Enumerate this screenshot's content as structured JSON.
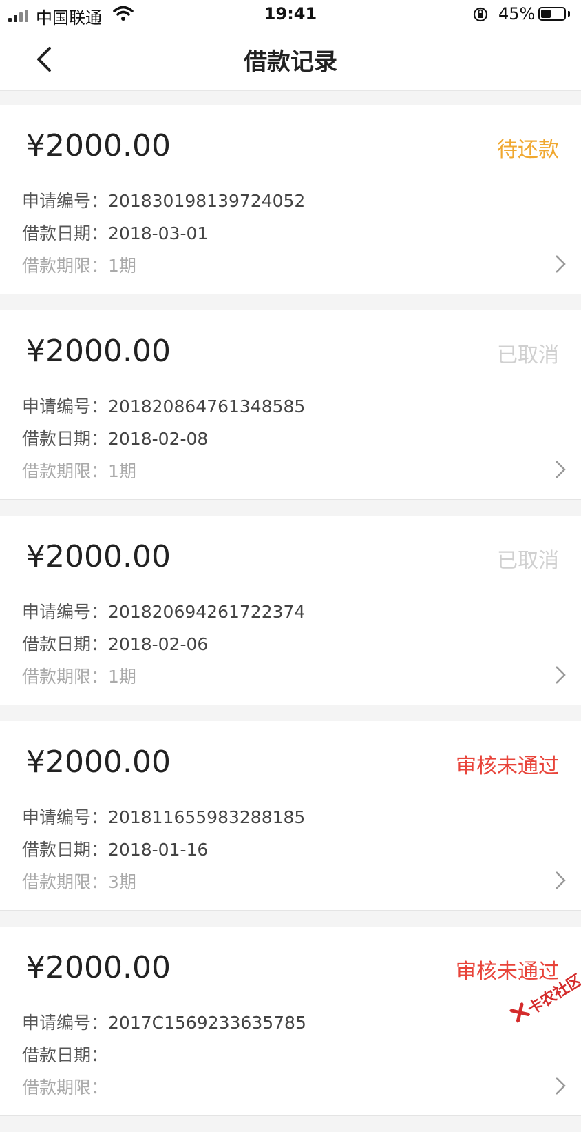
{
  "status_bar": {
    "carrier": "中国联通",
    "time": "19:41",
    "battery": "45%",
    "battery_level": 0.45
  },
  "nav": {
    "title": "借款记录"
  },
  "labels": {
    "app_no": "申请编号：",
    "date": "借款日期：",
    "term": "借款期限："
  },
  "colors": {
    "pending": "#f0a830",
    "cancelled": "#d0d0d0",
    "rejected": "#e8443a"
  },
  "records": [
    {
      "amount": "¥2000.00",
      "status": "待还款",
      "status_type": "pending",
      "app_no": "201830198139724052",
      "date": "2018-03-01",
      "term": "1期"
    },
    {
      "amount": "¥2000.00",
      "status": "已取消",
      "status_type": "cancelled",
      "app_no": "201820864761348585",
      "date": "2018-02-08",
      "term": "1期"
    },
    {
      "amount": "¥2000.00",
      "status": "已取消",
      "status_type": "cancelled",
      "app_no": "201820694261722374",
      "date": "2018-02-06",
      "term": "1期"
    },
    {
      "amount": "¥2000.00",
      "status": "审核未通过",
      "status_type": "rejected",
      "app_no": "201811655983288185",
      "date": "2018-01-16",
      "term": "3期"
    },
    {
      "amount": "¥2000.00",
      "status": "审核未通过",
      "status_type": "rejected",
      "app_no": "2017C1569233635785",
      "date": "",
      "term": ""
    }
  ],
  "watermark": {
    "text": "卡农社区"
  }
}
